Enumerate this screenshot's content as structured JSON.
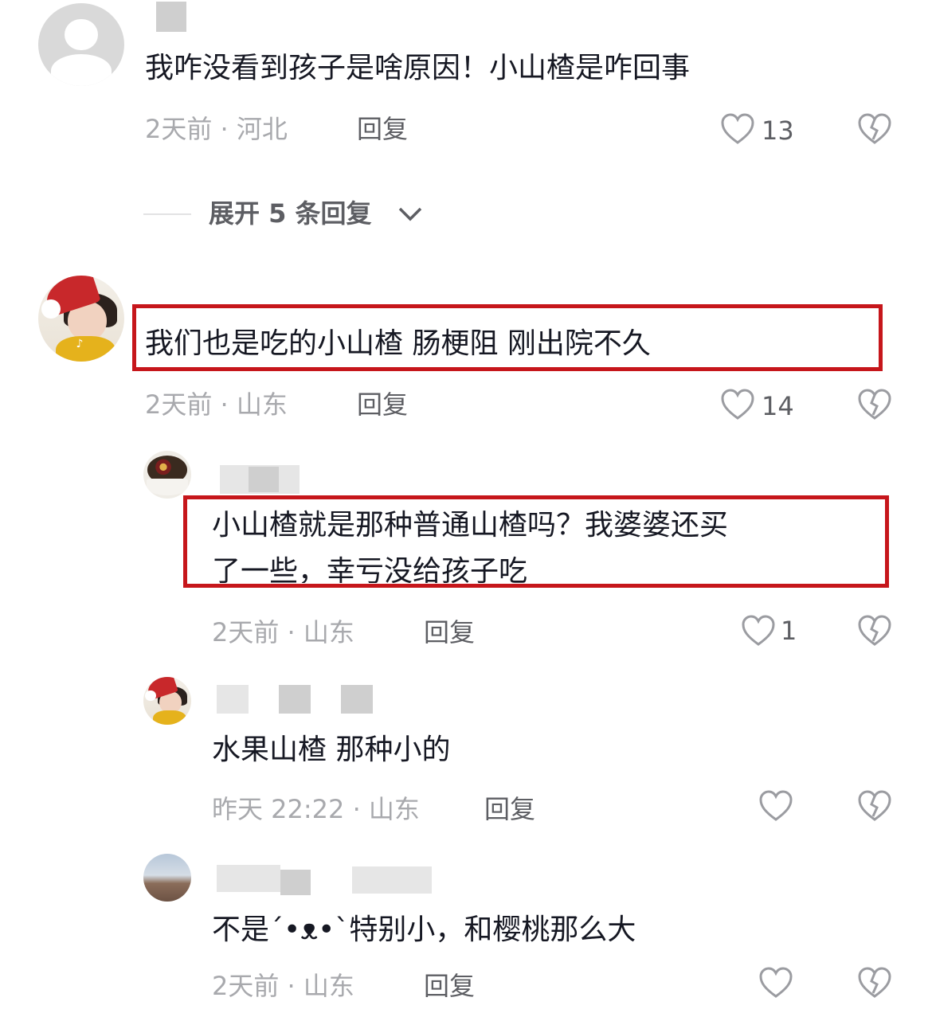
{
  "colors": {
    "highlight": "#c6161b",
    "text": "#161823",
    "meta": "#a8a9ad",
    "reply": "#5d5e63"
  },
  "comments": [
    {
      "text": "我咋没看到孩子是啥原因！小山楂是咋回事",
      "time_location": "2天前 · 河北",
      "reply_label": "回复",
      "likes": "13",
      "avatar_icon": "default-avatar-icon"
    },
    {
      "text": "我们也是吃的小山楂 肠梗阻 刚出院不久",
      "time_location": "2天前 · 山东",
      "reply_label": "回复",
      "likes": "14",
      "avatar_icon": "santa-girl-avatar"
    }
  ],
  "expand": {
    "label": "展开 5 条回复",
    "icon": "chevron-down-icon"
  },
  "replies": [
    {
      "text_line1": "小山楂就是那种普通山楂吗？我婆婆还买",
      "text_line2": "了一些，幸亏没给孩子吃",
      "time_location": "2天前 · 山东",
      "reply_label": "回复",
      "likes": "1",
      "avatar_icon": "cake-avatar"
    },
    {
      "text": "水果山楂 那种小的",
      "time_location": "昨天 22:22 · 山东",
      "reply_label": "回复",
      "likes": "",
      "avatar_icon": "santa-girl-avatar"
    },
    {
      "text": "不是´•ᴥ•`特别小，和樱桃那么大",
      "time_location": "2天前 · 山东",
      "reply_label": "回复",
      "likes": "",
      "avatar_icon": "landscape-avatar"
    }
  ]
}
